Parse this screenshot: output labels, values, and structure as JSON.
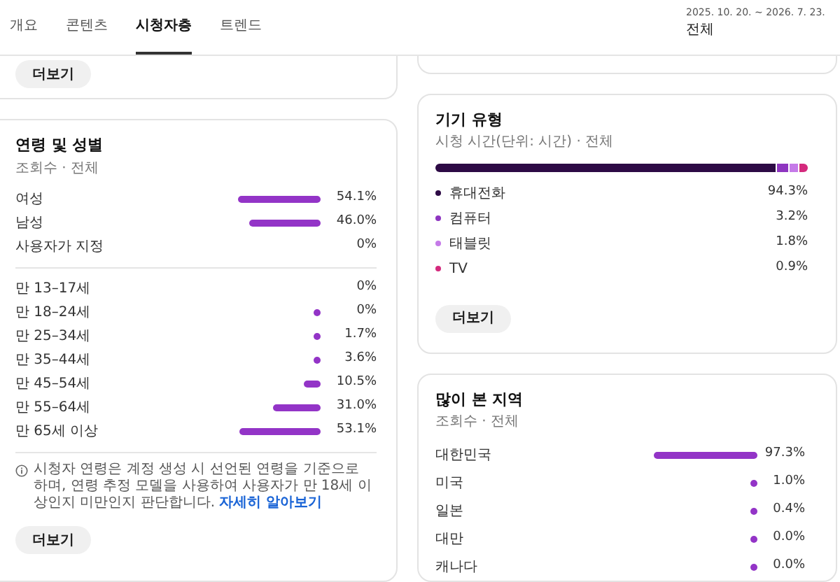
{
  "tabs": [
    {
      "label": "개요",
      "selected": false
    },
    {
      "label": "콘텐츠",
      "selected": false
    },
    {
      "label": "시청자층",
      "selected": true
    },
    {
      "label": "트렌드",
      "selected": false
    }
  ],
  "date_range": {
    "dates": "2025. 10. 20. ~ 2026. 7. 23.",
    "value": "전체"
  },
  "top_left_card": {
    "button": "더보기"
  },
  "age_gender": {
    "title": "연령 및 성별",
    "subtitle": "조회수 · 전체",
    "gender": [
      {
        "label": "여성",
        "kind": "bar",
        "value": "54.1%"
      },
      {
        "label": "남성",
        "kind": "bar",
        "value": "46.0%"
      },
      {
        "label": "사용자가 지정",
        "kind": "none",
        "value": "0%"
      }
    ],
    "age": [
      {
        "label": "만 13–17세",
        "kind": "none",
        "value": "0%"
      },
      {
        "label": "만 18–24세",
        "kind": "bar",
        "value": "0%"
      },
      {
        "label": "만 25–34세",
        "kind": "bar",
        "value": "1.7%"
      },
      {
        "label": "만 35–44세",
        "kind": "bar",
        "value": "3.6%"
      },
      {
        "label": "만 45–54세",
        "kind": "bar",
        "value": "10.5%"
      },
      {
        "label": "만 55–64세",
        "kind": "bar",
        "value": "31.0%"
      },
      {
        "label": "만 65세 이상",
        "kind": "bar",
        "value": "53.1%"
      }
    ],
    "note": "시청자 연령은 계정 생성 시 선언된 연령을 기준으로 하며, 연령 추정 모델을 사용하여 사용자가 만 18세 이상인지 미만인지 판단합니다.",
    "note_link": "자세히 알아보기",
    "button": "더보기"
  },
  "device_type": {
    "title": "기기 유형",
    "subtitle": "시청 시간(단위: 시간) · 전체",
    "devices": [
      {
        "label": "휴대전화",
        "value": "94.3%",
        "color": "#2d0a45"
      },
      {
        "label": "컴퓨터",
        "value": "3.2%",
        "color": "#8e35c0"
      },
      {
        "label": "태블릿",
        "value": "1.8%",
        "color": "#c57ae8"
      },
      {
        "label": "TV",
        "value": "0.9%",
        "color": "#d42a7d"
      }
    ],
    "button": "더보기"
  },
  "top_regions": {
    "title": "많이 본 지역",
    "subtitle": "조회수 · 전체",
    "regions": [
      {
        "label": "대한민국",
        "kind": "bar",
        "value": "97.3%"
      },
      {
        "label": "미국",
        "kind": "bar",
        "value": "1.0%"
      },
      {
        "label": "일본",
        "kind": "bar",
        "value": "0.4%"
      },
      {
        "label": "대만",
        "kind": "bar",
        "value": "0.0%"
      },
      {
        "label": "캐나다",
        "kind": "bar",
        "value": "0.0%"
      }
    ]
  }
}
